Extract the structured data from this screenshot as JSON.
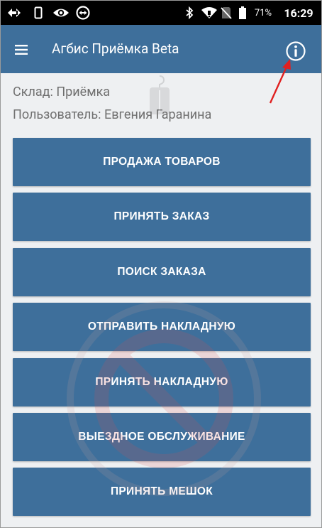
{
  "status_bar": {
    "battery_percent": "71%",
    "time": "16:29",
    "left_icons": [
      "signal-sync-icon",
      "sim-card-icon",
      "eye-icon",
      "remote-icon"
    ],
    "right_icons": [
      "bluetooth-icon",
      "wifi-icon",
      "no-sim-icon",
      "battery-icon"
    ]
  },
  "app_bar": {
    "title": "Агбис Приёмка Beta",
    "menu_icon": "hamburger-menu-icon",
    "info_icon": "info-icon",
    "background_color": "#3e6f9b"
  },
  "session": {
    "warehouse_line": "Склад: Приёмка",
    "user_line": "Пользователь: Евгения Гаранина"
  },
  "actions": [
    {
      "label": "ПРОДАЖА ТОВАРОВ"
    },
    {
      "label": "ПРИНЯТЬ ЗАКАЗ"
    },
    {
      "label": "ПОИСК ЗАКАЗА"
    },
    {
      "label": "ОТПРАВИТЬ НАКЛАДНУЮ"
    },
    {
      "label": "ПРИНЯТЬ НАКЛАДНУЮ"
    },
    {
      "label": "ВЫЕЗДНОЕ ОБСЛУЖИВАНИЕ"
    },
    {
      "label": "ПРИНЯТЬ МЕШОК"
    }
  ],
  "colors": {
    "accent": "#3e6f9b",
    "background": "#eef0f2",
    "annotation_arrow": "#e02020"
  }
}
